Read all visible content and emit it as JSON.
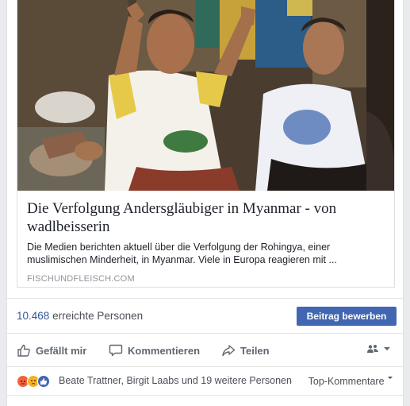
{
  "link_preview": {
    "title": "Die Verfolgung Andersgläubiger in Myanmar - von wadlbeisserin",
    "description": "Die Medien berichten aktuell über die Verfolgung der Rohingya, einer muslimischen Minderheit, in Myanmar. Viele in Europa reagieren mit ...",
    "domain": "FISCHUNDFLEISCH.COM"
  },
  "reach": {
    "count": "10.468",
    "label": "erreichte Personen",
    "boost_label": "Beitrag bewerben"
  },
  "actions": {
    "like": "Gefällt mir",
    "comment": "Kommentieren",
    "share": "Teilen"
  },
  "reactions": {
    "names": "Beate Trattner, Birgit Laabs und 19 weitere Personen",
    "sort_label": "Top-Kommentare",
    "colors": {
      "angry": "#f0623c",
      "sad": "#f7b125",
      "like": "#4267b2"
    }
  },
  "colors": {
    "accent": "#4267b2",
    "link": "#365899"
  }
}
